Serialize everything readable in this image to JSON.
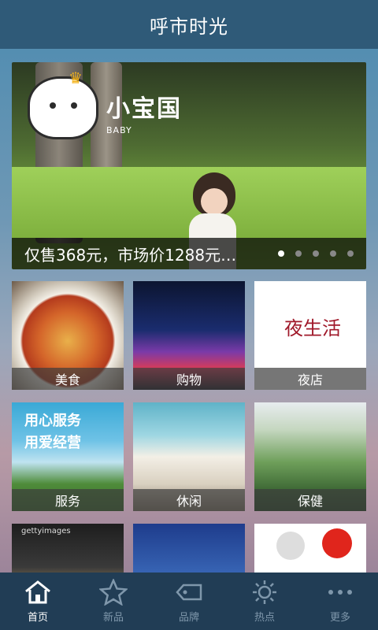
{
  "header": {
    "title": "呼市时光"
  },
  "banner": {
    "logo_text": "小宝国",
    "logo_sub": "BABY",
    "caption": "仅售368元，市场价1288元…",
    "dots": 5,
    "active_dot": 1
  },
  "grid": {
    "tiles": [
      {
        "label": "美食"
      },
      {
        "label": "购物"
      },
      {
        "label": "夜店",
        "logo": "夜生活"
      },
      {
        "label": "服务",
        "slogan_line1": "用心服务",
        "slogan_line2": "用爱经营"
      },
      {
        "label": "休闲"
      },
      {
        "label": "保健"
      },
      {
        "badge": "gettyimages"
      },
      {},
      {}
    ]
  },
  "tabbar": {
    "items": [
      {
        "label": "首页",
        "icon": "home-icon",
        "active": true
      },
      {
        "label": "新品",
        "icon": "star-new-icon"
      },
      {
        "label": "品牌",
        "icon": "tag-icon"
      },
      {
        "label": "热点",
        "icon": "sun-icon"
      },
      {
        "label": "更多",
        "icon": "more-icon"
      }
    ]
  },
  "colors": {
    "topbar": "#2f5a78",
    "tabbar": "#213d55",
    "tab_active": "#ffffff",
    "tab_inactive": "#7f97ab"
  }
}
